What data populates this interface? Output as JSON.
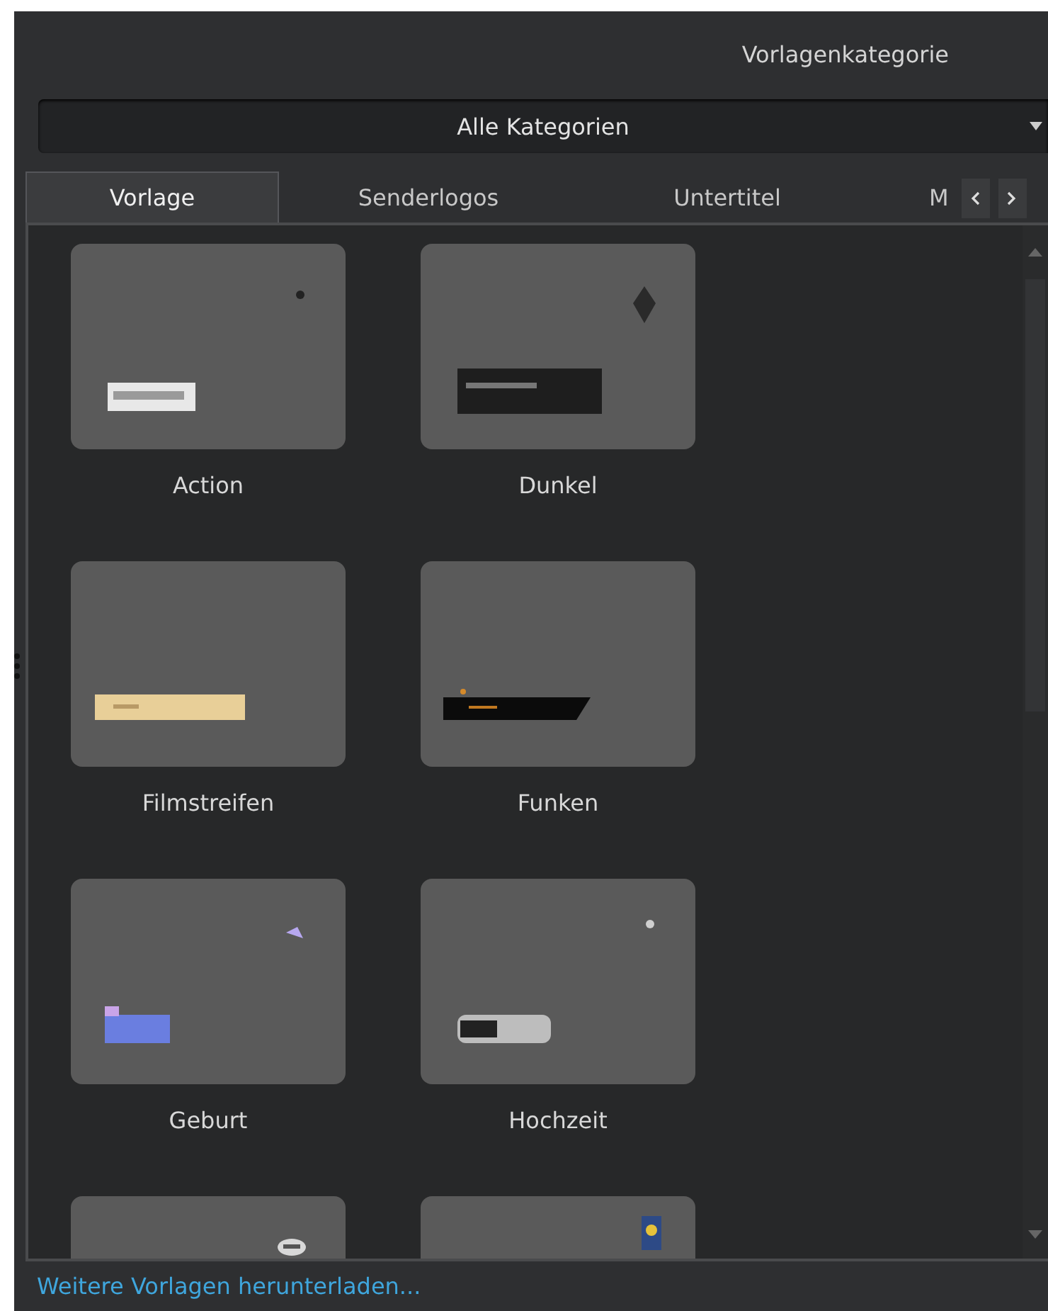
{
  "header": {
    "title": "Vorlagenkategorie"
  },
  "category_select": {
    "value": "Alle Kategorien"
  },
  "tabs": [
    {
      "label": "Vorlage",
      "selected": true
    },
    {
      "label": "Senderlogos",
      "selected": false
    },
    {
      "label": "Untertitel",
      "selected": false
    },
    {
      "label": "M",
      "selected": false
    }
  ],
  "templates": [
    {
      "kind": "picture",
      "label": "Action"
    },
    {
      "kind": "picture",
      "label": "Dunkel"
    },
    {
      "kind": "picture",
      "label": "Filmstreifen"
    },
    {
      "kind": "picture",
      "label": "Funken"
    },
    {
      "kind": "picture",
      "label": "Geburt"
    },
    {
      "kind": "picture",
      "label": "Hochzeit"
    },
    {
      "kind": "picture"
    },
    {
      "kind": "picture"
    }
  ],
  "footer_link": "Weitere Vorlagen herunterladen..."
}
